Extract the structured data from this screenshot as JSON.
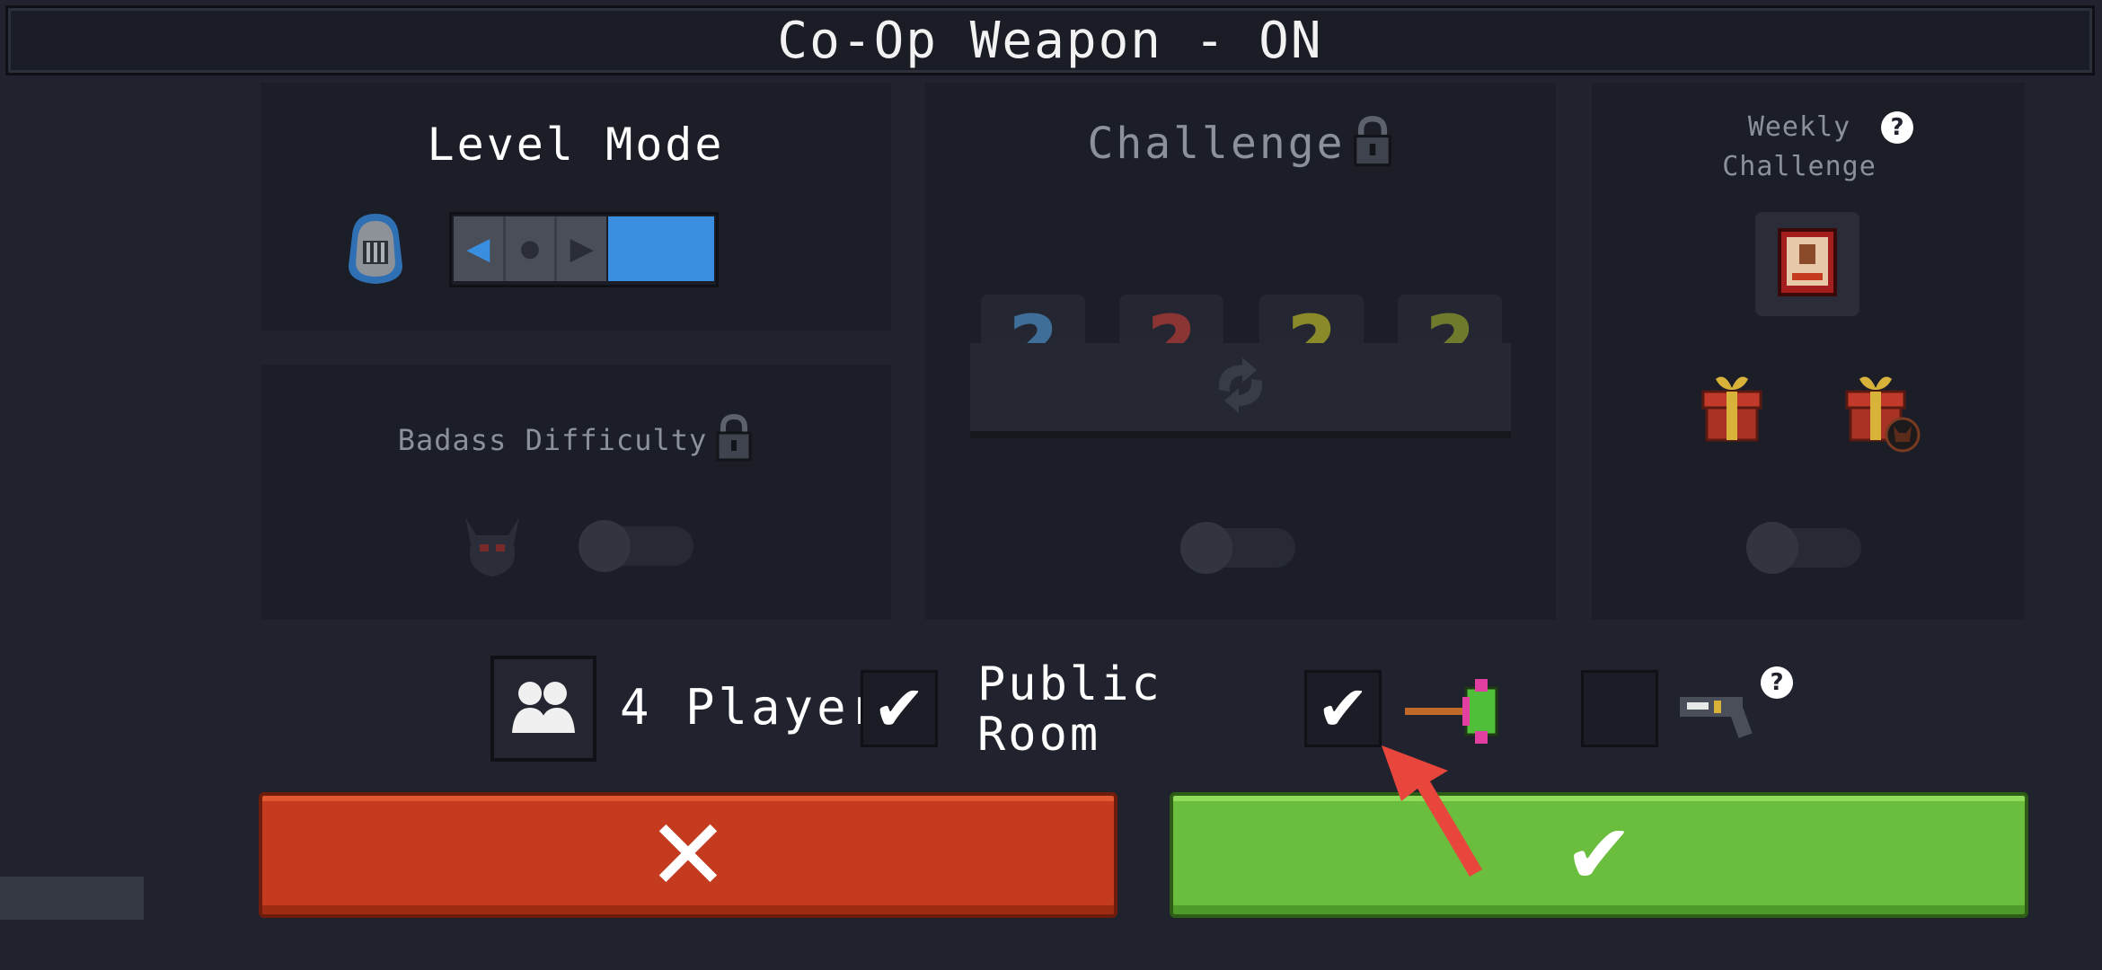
{
  "header": {
    "title": "Co-Op Weapon - ON"
  },
  "level_mode": {
    "label": "Level Mode",
    "state": "on"
  },
  "badass": {
    "label": "Badass Difficulty",
    "locked": true,
    "state": "off"
  },
  "challenge": {
    "label": "Challenge",
    "locked": true,
    "slots": [
      {
        "glyph": "?",
        "color": "#3f6f98"
      },
      {
        "glyph": "?",
        "color": "#8a3434"
      },
      {
        "glyph": "?",
        "color": "#8a8a2a"
      },
      {
        "glyph": "?",
        "color": "#6f7a2c"
      }
    ],
    "state": "off"
  },
  "weekly": {
    "label_line1": "Weekly",
    "label_line2": "Challenge",
    "help_glyph": "?",
    "state": "off"
  },
  "players": {
    "label": "4 Players"
  },
  "public_room": {
    "line1": "Public",
    "line2": "Room",
    "checked": true,
    "check_glyph": "✔"
  },
  "coop_weapon": {
    "checked": true,
    "check_glyph": "✔"
  },
  "extra_option": {
    "checked": false,
    "help_glyph": "?"
  },
  "buttons": {
    "cancel_glyph": "✕",
    "confirm_glyph": "✔"
  },
  "colors": {
    "cancel": "#c43b1f",
    "confirm": "#6abd3d",
    "toggle_on": "#3a8ee0",
    "arrow": "#e8453c"
  }
}
